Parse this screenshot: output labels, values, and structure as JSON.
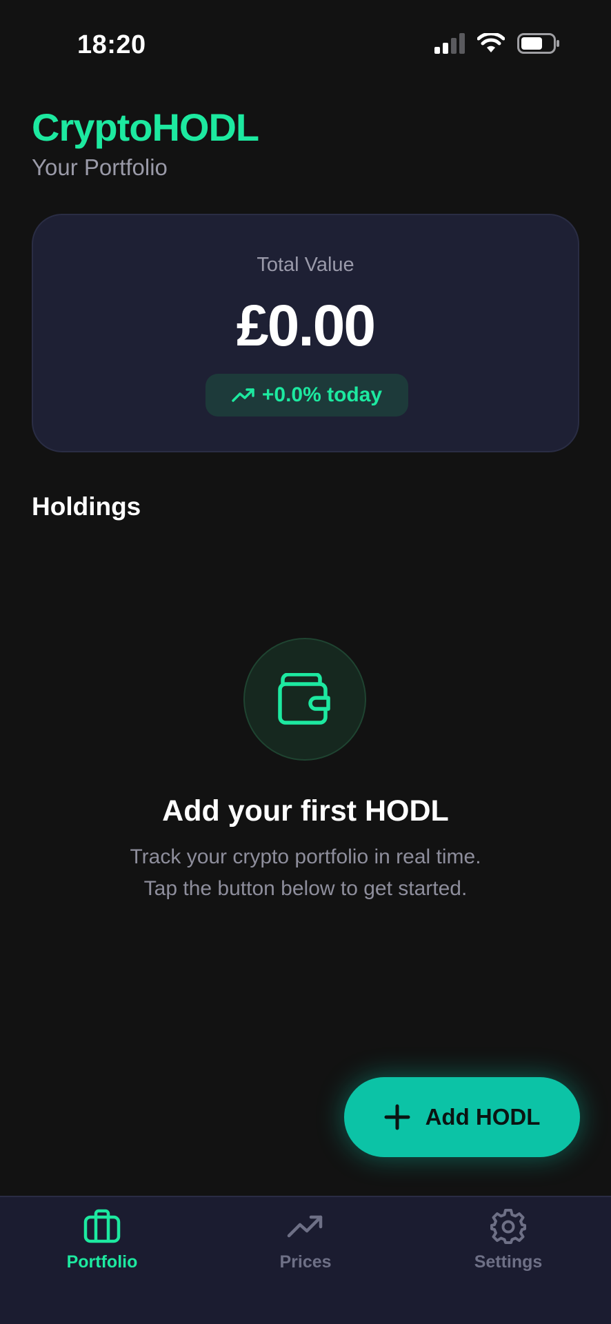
{
  "status_bar": {
    "time": "18:20"
  },
  "header": {
    "title": "CryptoHODL",
    "subtitle": "Your Portfolio"
  },
  "summary": {
    "label": "Total Value",
    "amount": "£0.00",
    "change": "+0.0% today"
  },
  "holdings": {
    "title": "Holdings",
    "empty_state": {
      "icon": "wallet-icon",
      "title": "Add your first HODL",
      "line1": "Track your crypto portfolio in real time.",
      "line2": "Tap the button below to get started."
    }
  },
  "fab": {
    "icon": "plus-icon",
    "label": "Add HODL"
  },
  "nav": {
    "items": [
      {
        "label": "Portfolio",
        "icon": "briefcase-icon",
        "active": true
      },
      {
        "label": "Prices",
        "icon": "trending-up-icon",
        "active": false
      },
      {
        "label": "Settings",
        "icon": "gear-icon",
        "active": false
      }
    ]
  },
  "colors": {
    "accent": "#1de9a0",
    "fab": "#0cc3a6",
    "background": "#121212",
    "card": "#1e2034",
    "nav_background": "#1b1c30",
    "inactive": "#6e7086"
  }
}
